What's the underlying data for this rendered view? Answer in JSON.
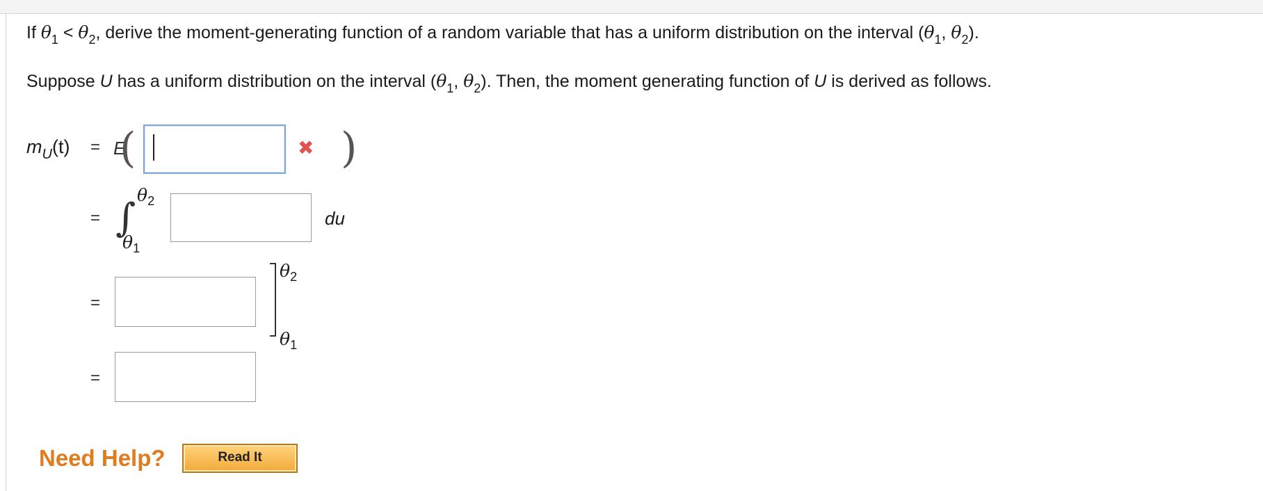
{
  "question": {
    "part1": "If ",
    "theta": "θ",
    "sub1": "1",
    "lt": " < ",
    "sub2": "2",
    "part2": ", derive the moment-generating function of a random variable that has a uniform distribution on the interval (",
    "comma": ", ",
    "close": ")."
  },
  "setup": {
    "part1": "Suppose ",
    "var": "U",
    "part2": " has a uniform distribution on the interval (",
    "part3": "). Then, the moment generating function of ",
    "part4": " is derived as follows."
  },
  "derivation": {
    "lhs_m": "m",
    "lhs_sub": "U",
    "lhs_t": "(t)",
    "equals": "=",
    "expect": "E",
    "paren_open": "(",
    "paren_close": ")",
    "integral": "∫",
    "upper": "θ",
    "upper_sub": "2",
    "lower": "θ",
    "lower_sub": "1",
    "du": "du",
    "incorrect_mark": "✖",
    "fields": [
      {
        "value": "",
        "placeholder": ""
      },
      {
        "value": "",
        "placeholder": ""
      },
      {
        "value": "",
        "placeholder": ""
      },
      {
        "value": "",
        "placeholder": ""
      }
    ]
  },
  "help": {
    "need_help": "Need Help?",
    "read_it": "Read It"
  },
  "colors": {
    "need_help": "#e07b1e",
    "incorrect": "#e25050",
    "active_border": "#7fa6d8"
  }
}
